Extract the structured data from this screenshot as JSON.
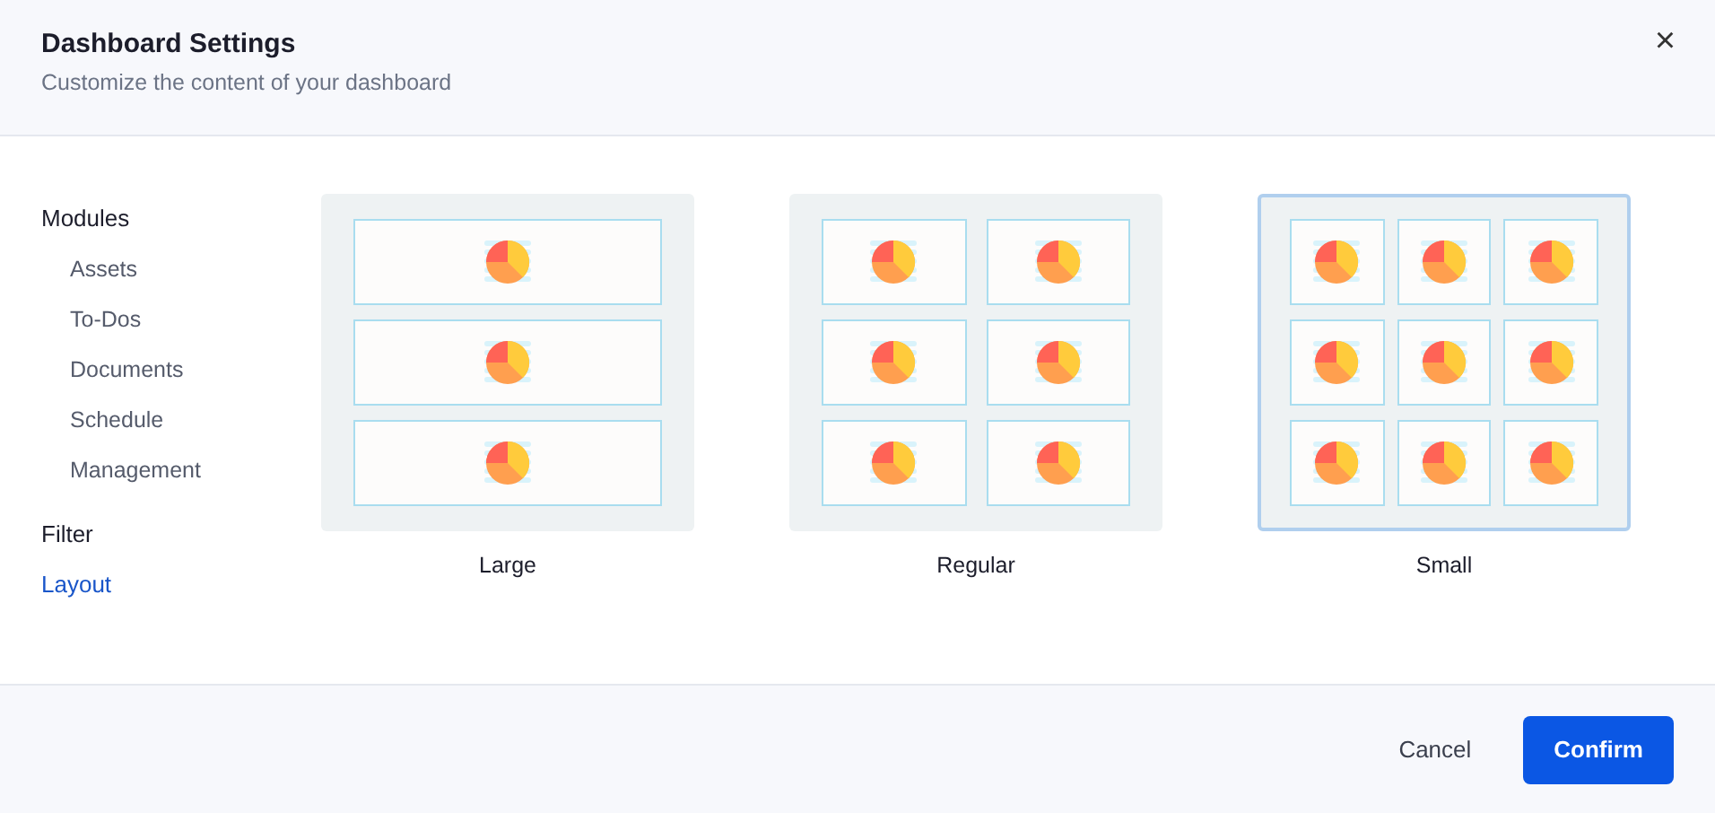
{
  "header": {
    "title": "Dashboard Settings",
    "subtitle": "Customize the content of your dashboard",
    "close": "×"
  },
  "sidebar": {
    "items": [
      {
        "label": "Modules",
        "selected": false,
        "children": [
          {
            "label": "Assets",
            "selected": false
          },
          {
            "label": "To-Dos",
            "selected": false
          },
          {
            "label": "Documents",
            "selected": false
          },
          {
            "label": "Schedule",
            "selected": false
          },
          {
            "label": "Management",
            "selected": false
          }
        ]
      },
      {
        "label": "Filter",
        "selected": false
      },
      {
        "label": "Layout",
        "selected": true
      }
    ]
  },
  "layouts": [
    {
      "kind": "large",
      "label": "Large",
      "selected": false
    },
    {
      "kind": "regular",
      "label": "Regular",
      "selected": false
    },
    {
      "kind": "small",
      "label": "Small",
      "selected": true
    }
  ],
  "footer": {
    "buttons": [
      {
        "kind": "secondary",
        "label": "Cancel"
      },
      {
        "kind": "primary",
        "label": "Confirm"
      }
    ]
  }
}
